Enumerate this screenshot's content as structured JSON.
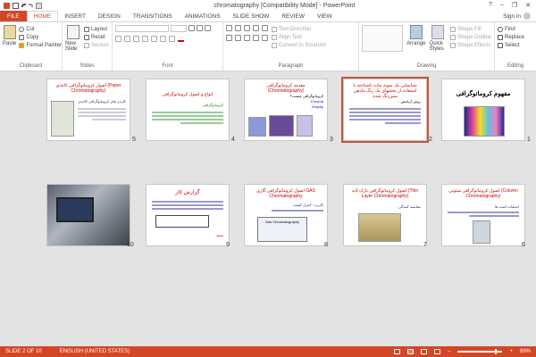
{
  "window": {
    "title": "chromatography [Compatibility Mode] - PowerPoint",
    "help": "?",
    "minimize": "–",
    "restore": "❐",
    "close": "✕"
  },
  "tabs": [
    {
      "label": "FILE"
    },
    {
      "label": "HOME"
    },
    {
      "label": "INSERT"
    },
    {
      "label": "DESIGN"
    },
    {
      "label": "TRANSITIONS"
    },
    {
      "label": "ANIMATIONS"
    },
    {
      "label": "SLIDE SHOW"
    },
    {
      "label": "REVIEW"
    },
    {
      "label": "VIEW"
    }
  ],
  "account": {
    "signin": "Sign in"
  },
  "ribbon": {
    "clipboard": {
      "label": "Clipboard",
      "paste": "Paste",
      "cut": "Cut",
      "copy": "Copy",
      "format_painter": "Format Painter"
    },
    "slides": {
      "label": "Slides",
      "new_slide": "New Slide",
      "layout": "Layout",
      "reset": "Reset",
      "section": "Section"
    },
    "font": {
      "label": "Font"
    },
    "paragraph": {
      "label": "Paragraph",
      "text_direction": "Text Direction",
      "align_text": "Align Text",
      "convert": "Convert to SmartArt"
    },
    "drawing": {
      "label": "Drawing",
      "arrange": "Arrange",
      "quick_styles": "Quick Styles",
      "shape_fill": "Shape Fill",
      "shape_outline": "Shape Outline",
      "shape_effects": "Shape Effects"
    },
    "editing": {
      "label": "Editing",
      "find": "Find",
      "replace": "Replace",
      "select": "Select"
    }
  },
  "slides": [
    {
      "num": "1",
      "title": "مفهوم کروماتوگرافی"
    },
    {
      "num": "2",
      "title": "شناسایی یک نمونه ماده ناشناخته با استفاده از بخشهای یک رنگ مادهی سبزرنگ شده"
    },
    {
      "num": "3",
      "title": "مقدمه کروماتوگرافی (Chromatography)"
    },
    {
      "num": "4",
      "title": "انواع و اصول کروماتوگرافی"
    },
    {
      "num": "5",
      "title": "اصول کروماتوگرافی کاغذی (Paper Chromatography)"
    },
    {
      "num": "6",
      "title": "اصول کروماتوگرافی ستونی (Column Chromatography)"
    },
    {
      "num": "7",
      "title": "اصول کروماتوگرافی نازک لایه (Thin Layer Chromatography)"
    },
    {
      "num": "8",
      "title": "اصول کروماتوگرافی گازی GAS Chromatography"
    },
    {
      "num": "9",
      "title": "گزارش کار"
    },
    {
      "num": "10",
      "title": ""
    }
  ],
  "slide_text": {
    "s2_body": "روش آزمایش :",
    "s3_body": "کروماتوگرافی چیست؟",
    "s3_chroma": "Chroma",
    "s3_graphy": "Graphy",
    "s4_body": "کروماتوگرافی",
    "s5_body": "کاربرد های کروماتوگرافی کاغذی",
    "s6_body": "استفاده کننده ها",
    "s7_body": "مقایسه کنندگی",
    "s8_label": "Gas Chromatography",
    "s8_body": "کاربرد : کنترل کیفیت",
    "s9_body": "نتیجه"
  },
  "status": {
    "slide": "SLIDE 2 OF 10",
    "language": "ENGLISH (UNITED STATES)",
    "zoom": "89%"
  }
}
